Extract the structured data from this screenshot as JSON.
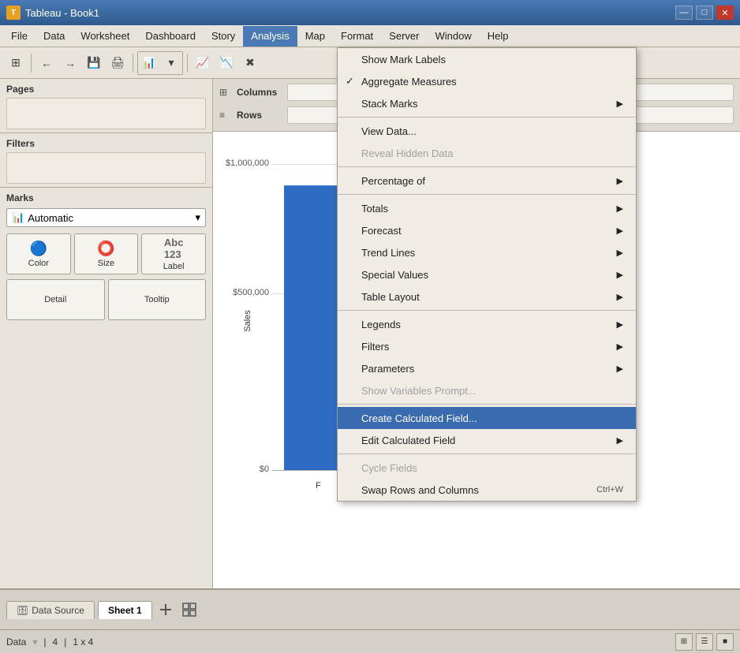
{
  "window": {
    "title": "Tableau - Book1",
    "icon_label": "T"
  },
  "title_bar_controls": {
    "minimize": "—",
    "maximize": "□",
    "close": "✕"
  },
  "menu_bar": {
    "items": [
      {
        "id": "file",
        "label": "File"
      },
      {
        "id": "data",
        "label": "Data"
      },
      {
        "id": "worksheet",
        "label": "Worksheet"
      },
      {
        "id": "dashboard",
        "label": "Dashboard"
      },
      {
        "id": "story",
        "label": "Story"
      },
      {
        "id": "analysis",
        "label": "Analysis",
        "active": true
      },
      {
        "id": "map",
        "label": "Map"
      },
      {
        "id": "format",
        "label": "Format"
      },
      {
        "id": "server",
        "label": "Server"
      },
      {
        "id": "window",
        "label": "Window"
      },
      {
        "id": "help",
        "label": "Help"
      }
    ]
  },
  "analysis_menu": {
    "items": [
      {
        "id": "show-mark-labels",
        "label": "Show Mark Labels",
        "checked": false,
        "has_arrow": false,
        "disabled": false,
        "shortcut": ""
      },
      {
        "id": "aggregate-measures",
        "label": "Aggregate Measures",
        "checked": true,
        "has_arrow": false,
        "disabled": false,
        "shortcut": ""
      },
      {
        "id": "stack-marks",
        "label": "Stack Marks",
        "checked": false,
        "has_arrow": true,
        "disabled": false,
        "shortcut": ""
      },
      {
        "id": "sep1",
        "type": "separator"
      },
      {
        "id": "view-data",
        "label": "View Data...",
        "checked": false,
        "has_arrow": false,
        "disabled": false,
        "shortcut": ""
      },
      {
        "id": "reveal-hidden",
        "label": "Reveal Hidden Data",
        "checked": false,
        "has_arrow": false,
        "disabled": true,
        "shortcut": ""
      },
      {
        "id": "sep2",
        "type": "separator"
      },
      {
        "id": "percentage-of",
        "label": "Percentage of",
        "checked": false,
        "has_arrow": true,
        "disabled": false,
        "shortcut": ""
      },
      {
        "id": "sep3",
        "type": "separator"
      },
      {
        "id": "totals",
        "label": "Totals",
        "checked": false,
        "has_arrow": true,
        "disabled": false,
        "shortcut": ""
      },
      {
        "id": "forecast",
        "label": "Forecast",
        "checked": false,
        "has_arrow": true,
        "disabled": false,
        "shortcut": ""
      },
      {
        "id": "trend-lines",
        "label": "Trend Lines",
        "checked": false,
        "has_arrow": true,
        "disabled": false,
        "shortcut": ""
      },
      {
        "id": "special-values",
        "label": "Special Values",
        "checked": false,
        "has_arrow": true,
        "disabled": false,
        "shortcut": ""
      },
      {
        "id": "table-layout",
        "label": "Table Layout",
        "checked": false,
        "has_arrow": true,
        "disabled": false,
        "shortcut": ""
      },
      {
        "id": "sep4",
        "type": "separator"
      },
      {
        "id": "legends",
        "label": "Legends",
        "checked": false,
        "has_arrow": true,
        "disabled": false,
        "shortcut": ""
      },
      {
        "id": "filters",
        "label": "Filters",
        "checked": false,
        "has_arrow": true,
        "disabled": false,
        "shortcut": ""
      },
      {
        "id": "parameters",
        "label": "Parameters",
        "checked": false,
        "has_arrow": true,
        "disabled": false,
        "shortcut": ""
      },
      {
        "id": "show-variables",
        "label": "Show Variables Prompt...",
        "checked": false,
        "has_arrow": false,
        "disabled": true,
        "shortcut": ""
      },
      {
        "id": "sep5",
        "type": "separator"
      },
      {
        "id": "create-calc",
        "label": "Create Calculated Field...",
        "checked": false,
        "has_arrow": false,
        "disabled": false,
        "shortcut": "",
        "highlighted": true
      },
      {
        "id": "edit-calc",
        "label": "Edit Calculated Field",
        "checked": false,
        "has_arrow": true,
        "disabled": false,
        "shortcut": ""
      },
      {
        "id": "sep6",
        "type": "separator"
      },
      {
        "id": "cycle-fields",
        "label": "Cycle Fields",
        "checked": false,
        "has_arrow": false,
        "disabled": true,
        "shortcut": ""
      },
      {
        "id": "swap-rows",
        "label": "Swap Rows and Columns",
        "checked": false,
        "has_arrow": false,
        "disabled": false,
        "shortcut": "Ctrl+W"
      }
    ]
  },
  "panels": {
    "pages_label": "Pages",
    "filters_label": "Filters",
    "marks_label": "Marks",
    "columns_label": "Columns",
    "rows_label": "Rows"
  },
  "marks_panel": {
    "dropdown_label": "Automatic",
    "buttons": [
      {
        "id": "color",
        "icon": "🔵",
        "label": "Color"
      },
      {
        "id": "size",
        "icon": "⭕",
        "label": "Size"
      },
      {
        "id": "label",
        "icon": "🔤",
        "label": "Label"
      },
      {
        "id": "detail",
        "label": "Detail"
      },
      {
        "id": "tooltip",
        "label": "Tooltip"
      }
    ]
  },
  "chart": {
    "y_axis_label": "Sales",
    "labels": [
      {
        "value": "$1,000,000",
        "percent": 85
      },
      {
        "value": "$500,000",
        "percent": 50
      },
      {
        "value": "$0",
        "percent": 0
      }
    ],
    "x_label": "F",
    "bar_height_percent": 78
  },
  "tabs": {
    "data_source_label": "Data Source",
    "sheet1_label": "Sheet 1"
  },
  "status_bar": {
    "data_label": "Data",
    "row_count": "4",
    "dimensions": "1 x 4"
  }
}
